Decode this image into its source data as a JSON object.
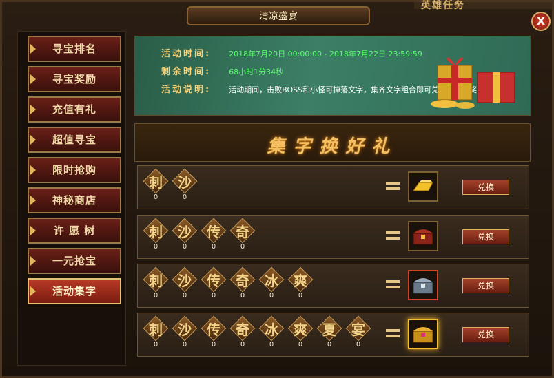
{
  "window": {
    "title": "清凉盛宴",
    "background_label": "英雄任务",
    "close_label": "X"
  },
  "sidebar": {
    "items": [
      {
        "label": "寻宝排名",
        "active": false
      },
      {
        "label": "寻宝奖励",
        "active": false
      },
      {
        "label": "充值有礼",
        "active": false
      },
      {
        "label": "超值寻宝",
        "active": false
      },
      {
        "label": "限时抢购",
        "active": false
      },
      {
        "label": "神秘商店",
        "active": false
      },
      {
        "label": "许 愿 树",
        "active": false
      },
      {
        "label": "一元抢宝",
        "active": false
      },
      {
        "label": "活动集字",
        "active": true
      }
    ]
  },
  "info": {
    "time_label": "活动时间:",
    "time_value": "2018年7月20日 00:00:00 - 2018年7月22日 23:59:59",
    "remaining_label": "剩余时间:",
    "remaining_value": "68小时1分34秒",
    "desc_label": "活动说明:",
    "desc_value": "活动期间，击败BOSS和小怪可掉落文字，集齐文字组合即可兑换相应的奖励。",
    "gift_icon": "gift-box-icon"
  },
  "banner": {
    "title": "集字换好礼"
  },
  "rows": [
    {
      "chars": [
        "刺",
        "沙"
      ],
      "counts": [
        "0",
        "0"
      ],
      "reward_icon": "gold-ingot-icon",
      "button": "兑换"
    },
    {
      "chars": [
        "刺",
        "沙",
        "传",
        "奇"
      ],
      "counts": [
        "0",
        "0",
        "0",
        "0"
      ],
      "reward_icon": "red-chest-icon",
      "button": "兑换"
    },
    {
      "chars": [
        "刺",
        "沙",
        "传",
        "奇",
        "冰",
        "爽"
      ],
      "counts": [
        "0",
        "0",
        "0",
        "0",
        "0",
        "0"
      ],
      "reward_icon": "silver-chest-icon",
      "button": "兑换"
    },
    {
      "chars": [
        "刺",
        "沙",
        "传",
        "奇",
        "冰",
        "爽",
        "夏",
        "宴"
      ],
      "counts": [
        "0",
        "0",
        "0",
        "0",
        "0",
        "0",
        "0",
        "0"
      ],
      "reward_icon": "golden-chest-icon",
      "button": "兑换"
    }
  ],
  "colors": {
    "accent": "#f2c060",
    "value_green": "#58ff6a",
    "button_red": "#a2422a"
  }
}
